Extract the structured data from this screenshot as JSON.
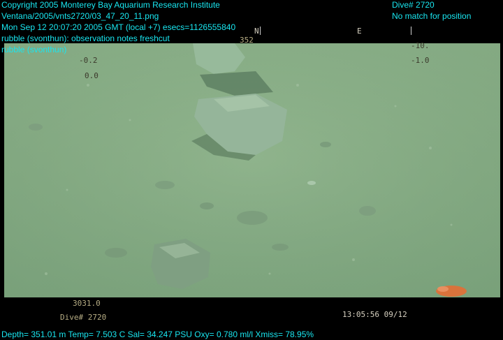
{
  "header_left": {
    "copyright": "Copyright 2005 Monterey Bay Aquarium Research Institute",
    "file_path": "Ventana/2005/vnts2720/03_47_20_11.png",
    "timestamp": "Mon Sep 12 20:07:20 2005 GMT (local +7)  esecs=1126555840",
    "annotation": "rubble (svonthun): observation notes freshcut",
    "annotation2": "rubble (svonthun)"
  },
  "header_right": {
    "dive": "Dive# 2720",
    "position": "No match for position"
  },
  "video_osd": {
    "heading_n": "N",
    "heading_e": "E",
    "heading_value": "352",
    "left_value1": "-0.2",
    "left_value2": "0.0",
    "right_value1": "-10.",
    "right_value2": "-1.0",
    "depth_counter": "3031.0",
    "dive_label": "Dive# 2720",
    "video_time": "13:05:56 09/12"
  },
  "footer": {
    "telemetry": "Depth= 351.01 m  Temp= 7.503 C  Sal= 34.247 PSU  Oxy= 0.780 ml/l  Xmiss= 78.95%"
  },
  "colors": {
    "overlay_text": "#19e6f0",
    "seafloor": "#88ad86"
  }
}
